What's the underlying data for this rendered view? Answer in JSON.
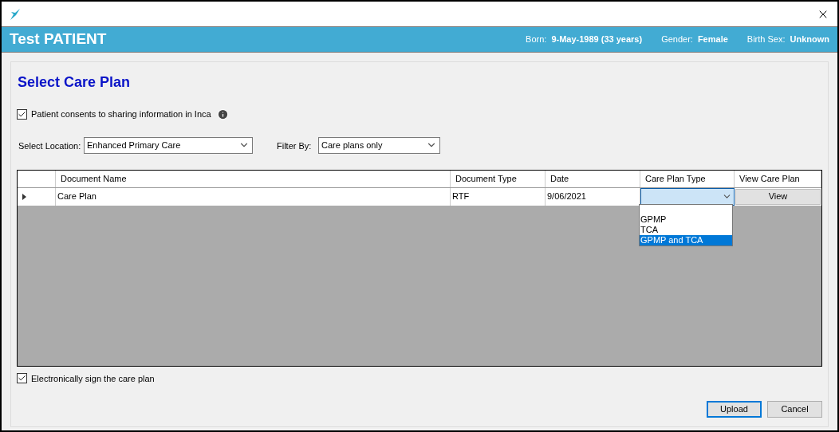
{
  "patient": {
    "name": "Test PATIENT",
    "fields": [
      {
        "label": "Born:",
        "value": "9-May-1989 (33 years)"
      },
      {
        "label": "Gender:",
        "value": "Female"
      },
      {
        "label": "Birth Sex:",
        "value": "Unknown"
      }
    ]
  },
  "title": "Select Care Plan",
  "consent": {
    "label": "Patient consents to sharing information in Inca",
    "checked": true
  },
  "location": {
    "label": "Select Location:",
    "value": "Enhanced Primary Care"
  },
  "filter": {
    "label": "Filter By:",
    "value": "Care plans only"
  },
  "table": {
    "columns": [
      "Document Name",
      "Document Type",
      "Date",
      "Care Plan Type",
      "View Care Plan"
    ],
    "rows": [
      {
        "current": true,
        "name": "Care Plan",
        "type": "RTF",
        "date": "9/06/2021",
        "button": "View"
      }
    ]
  },
  "dropdown": {
    "options": [
      {
        "label": "GPMP",
        "selected": false
      },
      {
        "label": "TCA",
        "selected": false
      },
      {
        "label": "GPMP and TCA",
        "selected": true
      }
    ]
  },
  "sign": {
    "label": "Electronically sign the care plan",
    "checked": true
  },
  "buttons": [
    {
      "label": "Upload",
      "default": true
    },
    {
      "label": "Cancel",
      "default": false
    }
  ]
}
